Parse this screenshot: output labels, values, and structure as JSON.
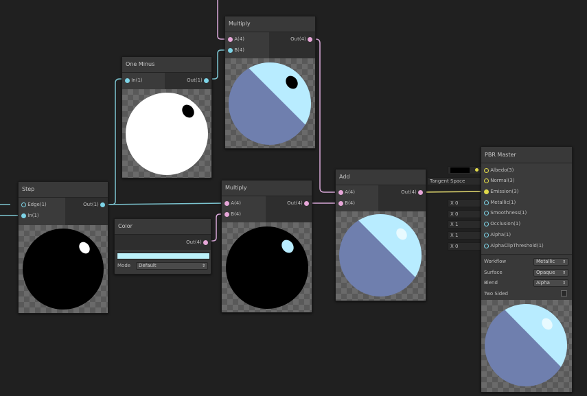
{
  "colors": {
    "canvas": "#202020",
    "node": "#393939",
    "wire_float": "#7cc5d1",
    "wire_vector": "#d8a7d8",
    "wire_emission": "#e3da6f",
    "preview_light": "#b8ecff",
    "preview_shadow": "#6f7fae"
  },
  "nodes": {
    "step": {
      "title": "Step",
      "inputs": [
        "Edge(1)",
        "In(1)"
      ],
      "output": "Out(1)"
    },
    "one_minus": {
      "title": "One Minus",
      "input": "In(1)",
      "output": "Out(1)"
    },
    "multiply_top": {
      "title": "Multiply",
      "inputs": [
        "A(4)",
        "B(4)"
      ],
      "output": "Out(4)"
    },
    "color": {
      "title": "Color",
      "output": "Out(4)",
      "swatch": "#bdf2fb",
      "mode_label": "Mode",
      "mode_value": "Default"
    },
    "multiply_bottom": {
      "title": "Multiply",
      "inputs": [
        "A(4)",
        "B(4)"
      ],
      "output": "Out(4)"
    },
    "add": {
      "title": "Add",
      "inputs": [
        "A(4)",
        "B(4)"
      ],
      "output": "Out(4)"
    },
    "pbr_master": {
      "title": "PBR Master",
      "inputs": [
        "Albedo(3)",
        "Normal(3)",
        "Emission(3)",
        "Metallic(1)",
        "Smoothness(1)",
        "Occlusion(1)",
        "Alpha(1)",
        "AlphaClipThreshold(1)"
      ],
      "normal_space": "Tangent Space",
      "fields": [
        {
          "axis": "X",
          "value": "0"
        },
        {
          "axis": "X",
          "value": "0"
        },
        {
          "axis": "X",
          "value": "1"
        },
        {
          "axis": "X",
          "value": "1"
        },
        {
          "axis": "X",
          "value": "0"
        }
      ],
      "settings": [
        {
          "label": "Workflow",
          "value": "Metallic"
        },
        {
          "label": "Surface",
          "value": "Opaque"
        },
        {
          "label": "Blend",
          "value": "Alpha"
        }
      ],
      "two_sided_label": "Two Sided"
    }
  }
}
